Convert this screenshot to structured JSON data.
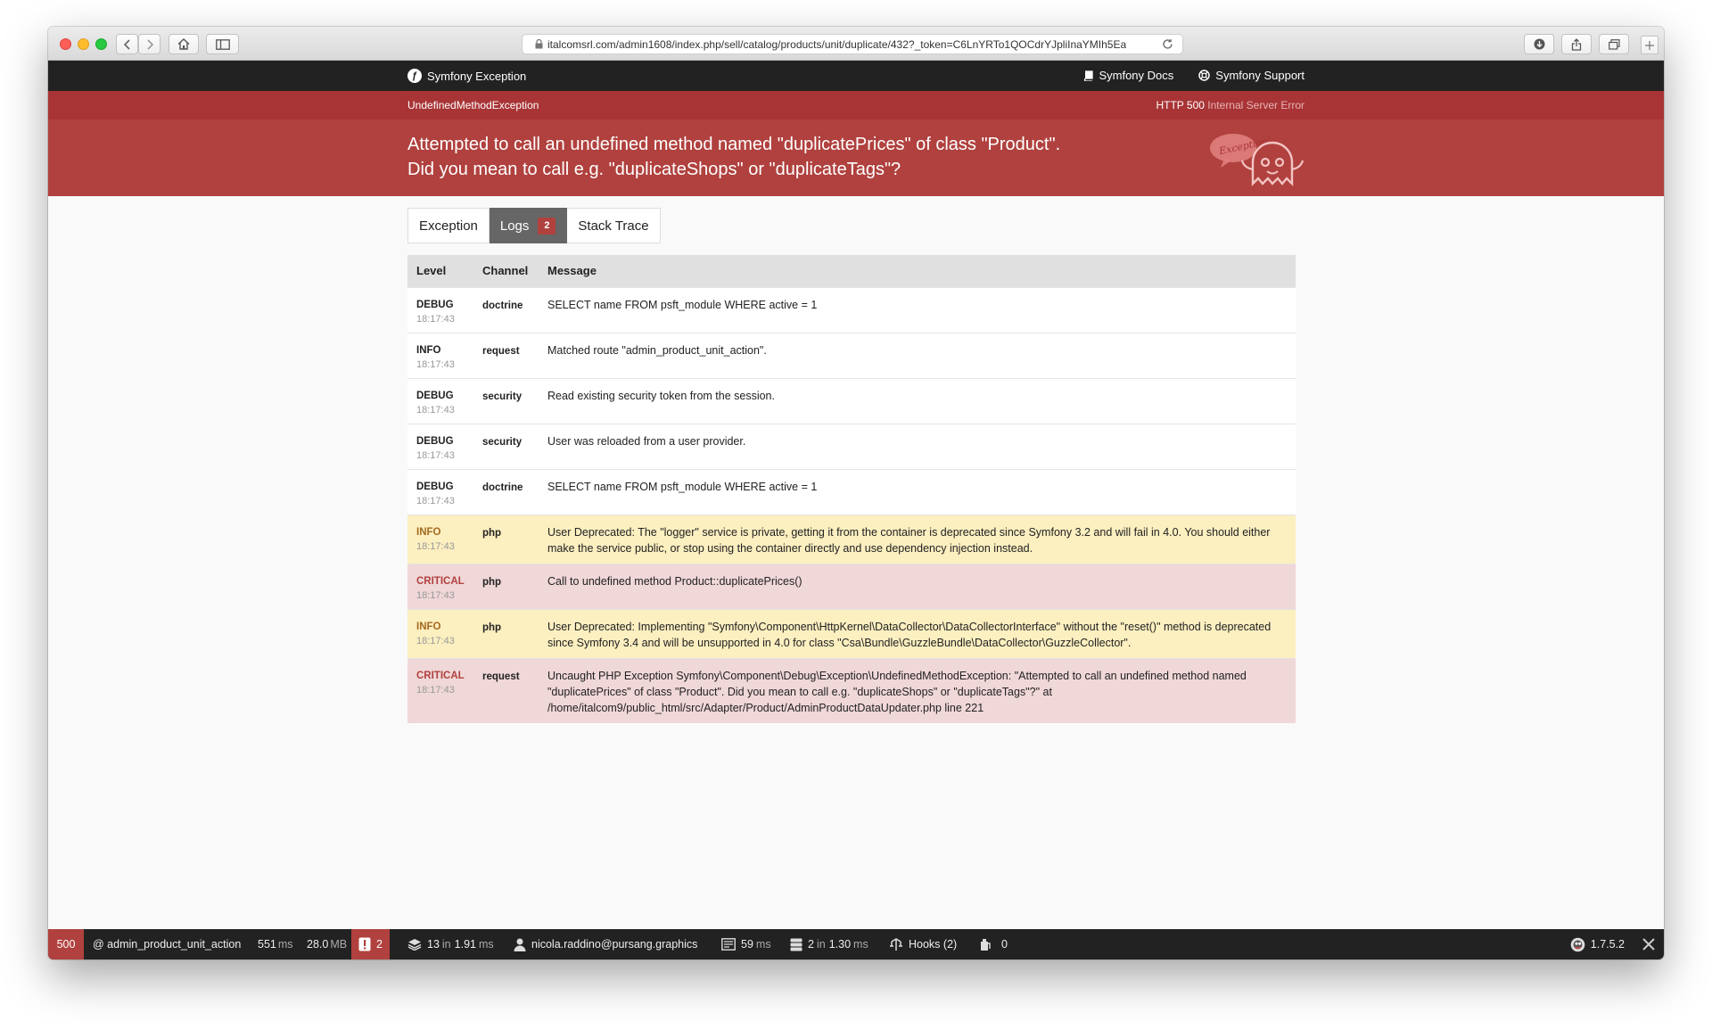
{
  "browser": {
    "url": "italcomsrl.com/admin1608/index.php/sell/catalog/products/unit/duplicate/432?_token=C6LnYRTo1QOCdrYJpliInaYMIh5Ea"
  },
  "header": {
    "brand": "Symfony Exception",
    "docs_link": "Symfony Docs",
    "support_link": "Symfony Support"
  },
  "exception": {
    "class": "UndefinedMethodException",
    "http_code": "HTTP 500",
    "http_text": "Internal Server Error",
    "message_line1": "Attempted to call an undefined method named \"duplicatePrices\" of class \"Product\".",
    "message_line2": "Did you mean to call e.g. \"duplicateShops\" or \"duplicateTags\"?",
    "ghost_text": "Exception!"
  },
  "tabs": {
    "exception": "Exception",
    "logs": "Logs",
    "logs_count": "2",
    "stack_trace": "Stack Trace"
  },
  "table": {
    "headers": [
      "Level",
      "Channel",
      "Message"
    ],
    "rows": [
      {
        "level": "DEBUG",
        "time": "18:17:43",
        "channel": "doctrine",
        "message": "SELECT name FROM psft_module WHERE active = 1"
      },
      {
        "level": "INFO",
        "time": "18:17:43",
        "channel": "request",
        "message": "Matched route \"admin_product_unit_action\"."
      },
      {
        "level": "DEBUG",
        "time": "18:17:43",
        "channel": "security",
        "message": "Read existing security token from the session."
      },
      {
        "level": "DEBUG",
        "time": "18:17:43",
        "channel": "security",
        "message": "User was reloaded from a user provider."
      },
      {
        "level": "DEBUG",
        "time": "18:17:43",
        "channel": "doctrine",
        "message": "SELECT name FROM psft_module WHERE active = 1"
      },
      {
        "level": "INFO",
        "time": "18:17:43",
        "channel": "php",
        "message": "User Deprecated: The \"logger\" service is private, getting it from the container is deprecated since Symfony 3.2 and will fail in 4.0. You should either make the service public, or stop using the container directly and use dependency injection instead."
      },
      {
        "level": "CRITICAL",
        "time": "18:17:43",
        "channel": "php",
        "message": "Call to undefined method Product::duplicatePrices()"
      },
      {
        "level": "INFO",
        "time": "18:17:43",
        "channel": "php",
        "message": "User Deprecated: Implementing \"Symfony\\Component\\HttpKernel\\DataCollector\\DataCollectorInterface\" without the \"reset()\" method is deprecated since Symfony 3.4 and will be unsupported in 4.0 for class \"Csa\\Bundle\\GuzzleBundle\\DataCollector\\GuzzleCollector\"."
      },
      {
        "level": "CRITICAL",
        "time": "18:17:43",
        "channel": "request",
        "message": "Uncaught PHP Exception Symfony\\Component\\Debug\\Exception\\UndefinedMethodException: \"Attempted to call an undefined method named \"duplicatePrices\" of class \"Product\". Did you mean to call e.g. \"duplicateShops\" or \"duplicateTags\"?\" at /home/italcom9/public_html/src/Adapter/Product/AdminProductDataUpdater.php line 221"
      }
    ]
  },
  "toolbar": {
    "status": "500",
    "route": "@ admin_product_unit_action",
    "time_value": "551",
    "time_unit": "ms",
    "memory_value": "28.0",
    "memory_unit": "MB",
    "errors": "2",
    "events_count": "13",
    "events_in": "in",
    "events_time": "1.91",
    "events_unit": "ms",
    "user": "nicola.raddino@pursang.graphics",
    "page_time": "59",
    "page_unit": "ms",
    "db_count": "2",
    "db_in": "in",
    "db_time": "1.30",
    "db_unit": "ms",
    "hooks": "Hooks (2)",
    "modules": "0",
    "version": "1.7.5.2"
  },
  "colors": {
    "brand_red": "#b0413e",
    "warning_bg": "#fcefc0",
    "critical_bg": "#f0d7d8"
  }
}
